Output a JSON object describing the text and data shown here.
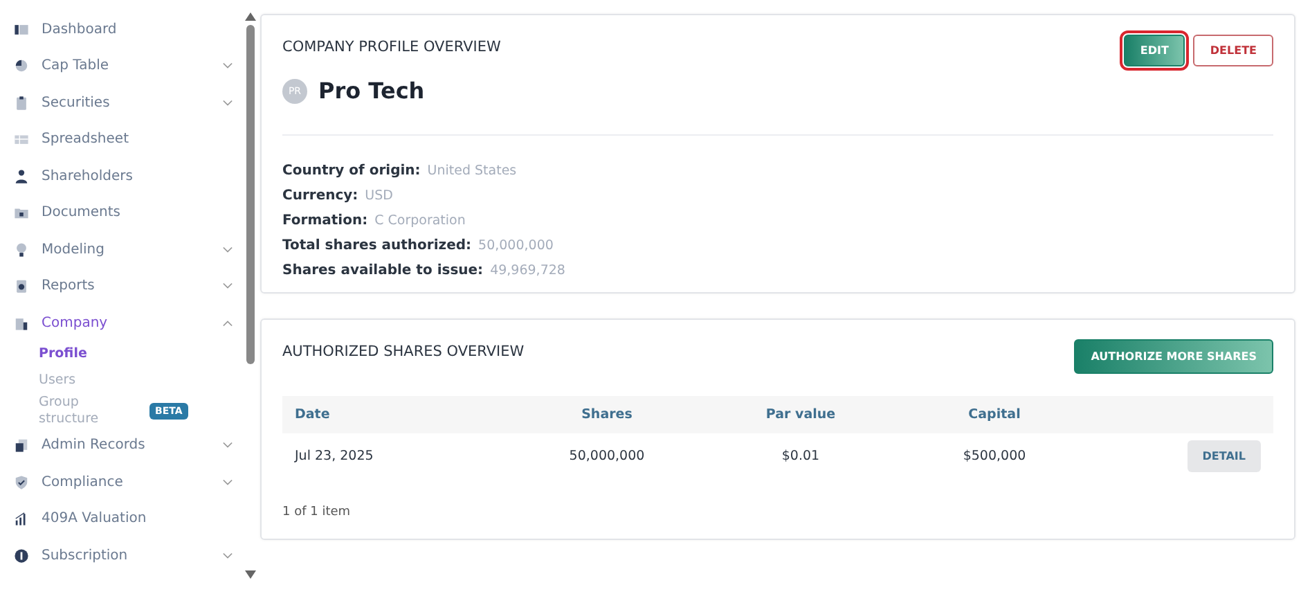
{
  "sidebar": {
    "items": [
      {
        "label": "Dashboard",
        "selected": false
      },
      {
        "label": "Cap Table",
        "expanded": false,
        "selected": false
      },
      {
        "label": "Securities",
        "expanded": false,
        "selected": false
      },
      {
        "label": "Spreadsheet",
        "selected": false
      },
      {
        "label": "Shareholders",
        "selected": false
      },
      {
        "label": "Documents",
        "selected": false
      },
      {
        "label": "Modeling",
        "expanded": false,
        "selected": false
      },
      {
        "label": "Reports",
        "expanded": false,
        "selected": false
      },
      {
        "label": "Company",
        "expanded": true,
        "selected": true,
        "children": [
          {
            "label": "Profile",
            "selected": true
          },
          {
            "label": "Users",
            "selected": false
          },
          {
            "label": "Group structure",
            "selected": false,
            "badge": "BETA"
          }
        ]
      },
      {
        "label": "Admin Records",
        "expanded": false,
        "selected": false
      },
      {
        "label": "Compliance",
        "expanded": false,
        "selected": false
      },
      {
        "label": "409A Valuation",
        "selected": false
      },
      {
        "label": "Subscription",
        "expanded": false,
        "selected": false
      }
    ]
  },
  "profile": {
    "title": "COMPANY PROFILE OVERVIEW",
    "buttons": [
      {
        "label": "EDIT",
        "kind": "primary",
        "focused": true
      },
      {
        "label": "DELETE",
        "kind": "danger",
        "focused": false
      }
    ],
    "avatar": "PR",
    "name": "Pro Tech",
    "fields": [
      {
        "label": "Country of origin:",
        "value": "United States"
      },
      {
        "label": "Currency:",
        "value": "USD"
      },
      {
        "label": "Formation:",
        "value": "C Corporation"
      },
      {
        "label": "Total shares authorized:",
        "value": "50,000,000"
      },
      {
        "label": "Shares available to issue:",
        "value": "49,969,728"
      }
    ]
  },
  "shares": {
    "title": "AUTHORIZED SHARES OVERVIEW",
    "button": "AUTHORIZE MORE SHARES",
    "columns": [
      "Date",
      "Shares",
      "Par value",
      "Capital"
    ],
    "rows": [
      {
        "cells": [
          "Jul 23, 2025",
          "50,000,000",
          "$0.01",
          "$500,000"
        ],
        "action": "DETAIL"
      }
    ],
    "footer": "1 of 1 item"
  }
}
